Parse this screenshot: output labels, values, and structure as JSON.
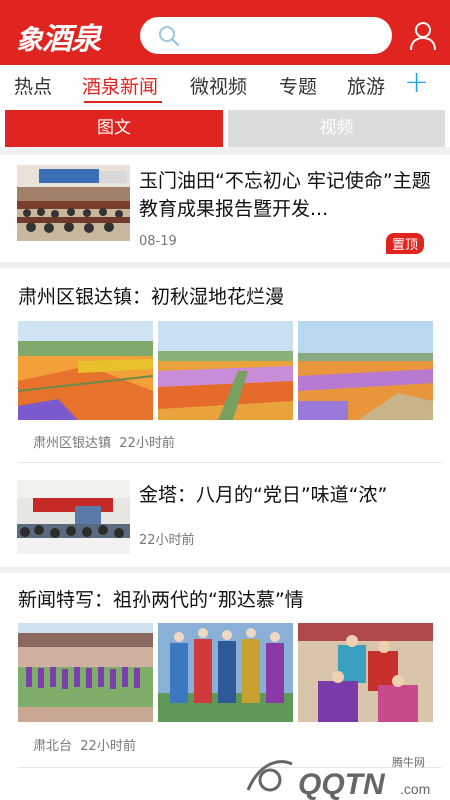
{
  "header": {
    "logo_text": "酒泉",
    "search_placeholder": "",
    "icons": [
      "search-icon",
      "user-icon"
    ],
    "brand_color": "#e0241f"
  },
  "tabs": [
    {
      "label": "热点",
      "active": false
    },
    {
      "label": "酒泉新闻",
      "active": true
    },
    {
      "label": "微视频",
      "active": false
    },
    {
      "label": "专题",
      "active": false
    },
    {
      "label": "旅游",
      "active": false
    }
  ],
  "segment": {
    "text_label": "图文",
    "video_label": "视频",
    "selected": "图文"
  },
  "articles": [
    {
      "title": "玉门油田“不忘初心  牢记使命”主题教育成果报告暨开发...",
      "date": "08-19",
      "badge": "置顶"
    },
    {
      "title": "肃州区银达镇：初秋湿地花烂漫",
      "source": "肃州区银达镇",
      "time": "22小时前"
    },
    {
      "title": "金塔：八月的“党日”味道“浓”",
      "time": "22小时前"
    },
    {
      "title": "新闻特写：祖孙两代的“那达慕”情",
      "source": "肃北台",
      "time": "22小时前"
    }
  ],
  "watermark": {
    "text_small": "腾牛网",
    "text_big": "QQTN.com"
  }
}
